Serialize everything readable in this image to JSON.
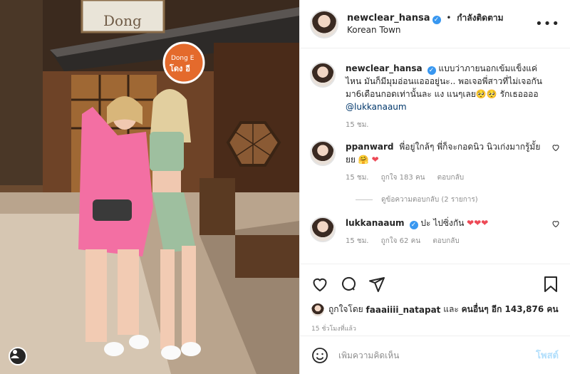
{
  "header": {
    "username": "newclear_hansa",
    "verified_mark": "✓",
    "separator": "•",
    "follow_label": "กำลังติดตาม",
    "location": "Korean Town",
    "more_label": "•••"
  },
  "photo": {
    "sign_text": "Dong E",
    "sign_thai": "โดง อี",
    "store_text": "Dong"
  },
  "comments": [
    {
      "username": "newclear_hansa",
      "text": "แบบว่าภายนอกเข้มแข็งแค่ไหน มันก็มีมุมอ่อนแอออยู่นะ.. พอเจอพี่สาวที่ไม่เจอกันมา6เดือนกอดเท่านั้นละ แง แนๆเลย🥺🥺 รักเธออออ",
      "mention": "@lukkanaaum",
      "time": "15 ชม."
    },
    {
      "username": "ppanward",
      "text": "พี่อยู่ใกล้ๆ พี่ก็จะกอดนิว นิวเก่งมากรู้มั้ยยย",
      "emoji": "🤗",
      "hearts": "❤",
      "time": "15 ชม.",
      "likes": "ถูกใจ 183 คน",
      "reply": "ตอบกลับ",
      "view_replies": "ดูข้อความตอบกลับ (2 รายการ)"
    },
    {
      "username": "lukkanaaum",
      "text": "ปะ ไปซิ่งกัน",
      "hearts": "❤❤❤",
      "time": "15 ชม.",
      "likes": "ถูกใจ 62 คน",
      "reply": "ตอบกลับ"
    }
  ],
  "likes_line": {
    "prefix": "ถูกใจโดย",
    "user": "faaaiiii_natapat",
    "middle": "และ",
    "others": "คนอื่นๆ อีก 143,876 คน"
  },
  "timestamp": "15 ชั่วโมงที่แล้ว",
  "add_comment": {
    "placeholder": "เพิ่มความคิดเห็น",
    "post_label": "โพสต์"
  },
  "icons": {
    "like": "heart-outline-icon",
    "comment": "comment-bubble-icon",
    "share": "paper-plane-icon",
    "save": "bookmark-icon",
    "emoji": "smiley-icon",
    "profile": "profile-glyph-icon"
  },
  "colors": {
    "verified": "#3897f0",
    "heart": "#ed4956",
    "post_disabled": "#b2dffc",
    "secondary_text": "#8e8e8e"
  }
}
